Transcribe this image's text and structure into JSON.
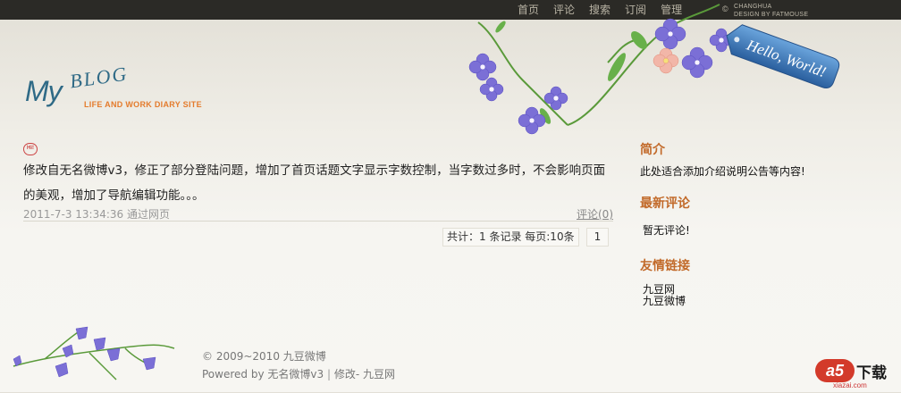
{
  "nav": {
    "items": [
      "首页",
      "评论",
      "搜索",
      "订阅",
      "管理"
    ]
  },
  "credit": {
    "line1": "CHANGHUA",
    "line2": "DESIGN BY FATMOUSE"
  },
  "logo": {
    "my": "My",
    "blog": "BLOG",
    "subtitle": "LIFE AND WORK DIARY SITE"
  },
  "hello_tag": "Hello, World!",
  "post": {
    "badge": "Hi!",
    "text": "修改自无名微博v3，修正了部分登陆问题，增加了首页话题文字显示字数控制，当字数过多时，不会影响页面的美观，增加了导航编辑功能。。。",
    "time": "2011-7-3 13:34:36",
    "source": "通过网页",
    "comments": "评论(0)"
  },
  "pager": {
    "info": "共计：1 条记录  每页:10条",
    "page": "1"
  },
  "sidebar": {
    "intro_title": "简介",
    "intro_text": "此处适合添加介绍说明公告等内容!",
    "comments_title": "最新评论",
    "comments_text": "暂无评论!",
    "links_title": "友情链接",
    "links": [
      "九豆网",
      "九豆微博"
    ]
  },
  "footer": {
    "copyright": "© 2009~2010 九豆微博",
    "powered": "Powered by 无名微博v3",
    "modified": "修改- 九豆网"
  },
  "watermark": {
    "logo": "a5",
    "label": "下载",
    "domain": "xiazai.com"
  },
  "colors": {
    "topbar": "#2b2a26",
    "accent": "#c26a2a",
    "logo_blue": "#2f6a86",
    "logo_orange": "#e47b2c",
    "flower": "#7b6fd6"
  }
}
